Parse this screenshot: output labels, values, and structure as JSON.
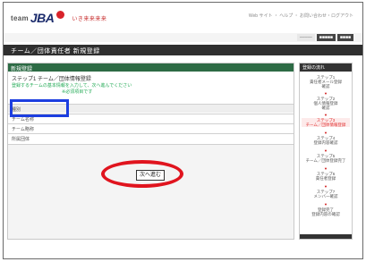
{
  "header": {
    "logo_prefix": "team",
    "logo_main": "JBA",
    "logo_sub": "いき来来来来",
    "links": "Web サイト ・ ヘルプ ・ お問い合わせ・ログアウト",
    "buttons": [
      "–––––",
      "■■■■■",
      "■■■■"
    ]
  },
  "titlebar": {
    "text": "チーム／団体責任者 新規登録"
  },
  "main": {
    "section_title": "新規登録",
    "form_title": "ステップ1 チーム／団体情報登録",
    "note1": "登録するチームの基本情報を入力して、次へ進んでください",
    "note2": "※必須項目です",
    "rows": [
      {
        "label": "種別"
      },
      {
        "label": "チーム名称"
      },
      {
        "label": "チーム略称"
      },
      {
        "label": "所属団体"
      }
    ],
    "submit_label": "次へ進む"
  },
  "sidebar": {
    "title": "登録の流れ",
    "steps": [
      {
        "text": "ステップ1\n責任者メール登録\n確認"
      },
      {
        "text": "ステップ2\n個人情報登録\n確認"
      },
      {
        "text": "ステップ3\nチーム／団体情報登録"
      },
      {
        "text": "ステップ4\n登録内容確認"
      },
      {
        "text": "ステップ5\nチーム／団体登録完了"
      },
      {
        "text": "ステップ6\n責任者登録"
      },
      {
        "text": "ステップ7\nメンバー確認"
      },
      {
        "text": "登録完了\n登録内容の確認"
      }
    ],
    "arrow": "▼"
  },
  "colors": {
    "section_green": "#2d6b45",
    "title_dark": "#2f2f2f",
    "highlight_blue": "#1c3ee0",
    "ellipse_red": "#e0141e"
  }
}
